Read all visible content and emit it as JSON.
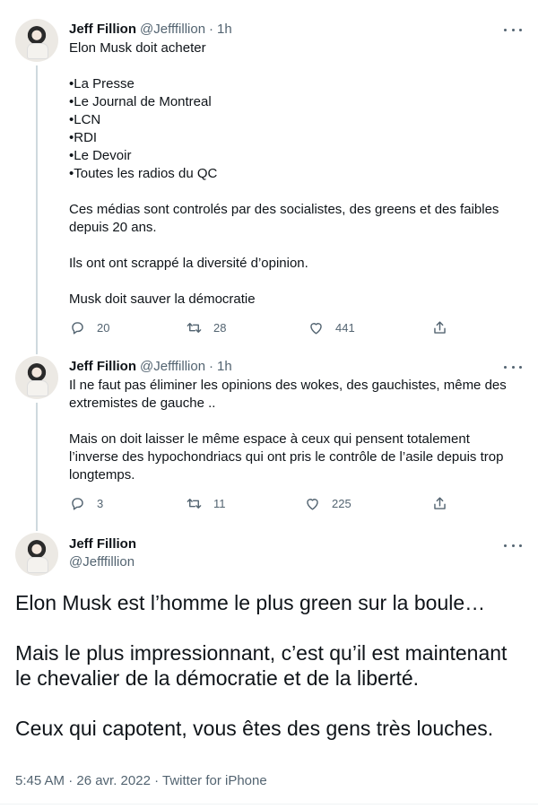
{
  "tweets": [
    {
      "name": "Jeff Fillion",
      "handle": "@Jefffillion",
      "time": "1h",
      "lines": [
        "Elon Musk doit acheter",
        "",
        "•La Presse",
        "•Le Journal de Montreal",
        "•LCN",
        "•RDI",
        "•Le Devoir",
        "•Toutes les radios du QC",
        "",
        "Ces médias sont controlés par des socialistes, des greens et des faibles depuis 20 ans.",
        "",
        "Ils ont ont scrappé la diversité d’opinion.",
        "",
        "Musk doit sauver la démocratie"
      ],
      "replies": "20",
      "retweets": "28",
      "likes": "441"
    },
    {
      "name": "Jeff Fillion",
      "handle": "@Jefffillion",
      "time": "1h",
      "lines": [
        "Il ne faut pas éliminer les opinions des wokes, des gauchistes, même des extremistes de gauche ..",
        "",
        "Mais on doit laisser le même espace à ceux qui pensent totalement l’inverse des hypochondriacs qui ont pris le contrôle de l’asile depuis trop longtemps."
      ],
      "replies": "3",
      "retweets": "11",
      "likes": "225"
    }
  ],
  "main_tweet": {
    "name": "Jeff Fillion",
    "handle": "@Jefffillion",
    "lines": [
      "Elon Musk est l’homme le plus green sur la boule…",
      "",
      "Mais le plus impressionnant, c’est qu’il est maintenant le chevalier de la démocratie et de la liberté.",
      "",
      "Ceux qui capotent, vous êtes des gens très louches."
    ],
    "meta": "5:45 AM · 26 avr. 2022 · Twitter for iPhone"
  },
  "icons": {
    "reply": "reply-icon",
    "retweet": "retweet-icon",
    "like": "heart-icon",
    "share": "share-icon",
    "more": "more-icon"
  },
  "colors": {
    "text": "#0f1419",
    "secondary": "#536471",
    "thread_line": "#cfd9de"
  }
}
